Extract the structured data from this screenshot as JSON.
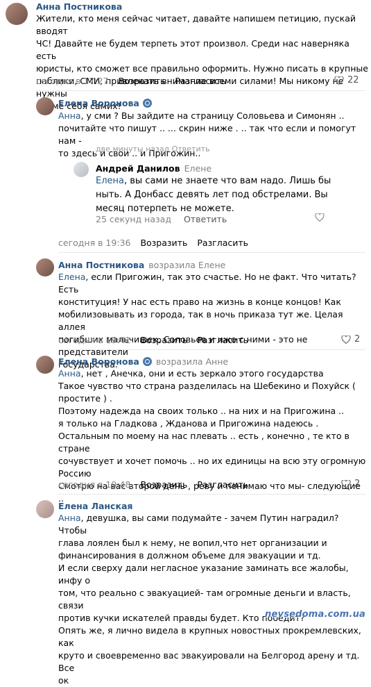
{
  "comments": [
    {
      "author": "Анна Постникова",
      "lines": [
        "Жители, кто меня сейчас читает, давайте напишем петицию, пускай вводят",
        "ЧС! Давайте не будем терпеть этот произвол. Среди нас наверняка есть",
        "юристы, кто сможет все правильно оформить. Нужно писать в крупные",
        "паблики, СМИ, привлекать внимание всеми силами! Мы никому не нужны",
        "кроме себя самих!"
      ],
      "time": "сегодня в 17:27",
      "reply": "Возразить",
      "share": "Разгласить",
      "likes": "22"
    },
    {
      "author": "Елена Воронова",
      "address": "Анна",
      "lines": [
        ", у сми ? Вы зайдите на страницу Соловьева и Симонян ..",
        "почитайте что пишут .. ... скрин ниже . .. так что если и помогут нам -",
        "то здесь и свои .. и Пригожин.."
      ],
      "ghost": "две минуты назад          Ответить"
    },
    {
      "author": "Андрей Данилов",
      "reply_to": "Елене",
      "address": "Елена",
      "lines": [
        ", вы сами не знаете что вам надо. Лишь бы",
        "ныть. А Донбасс девять лет под обстрелами. Вы",
        "месяц потерпеть не можете."
      ],
      "time": "25 секунд назад",
      "reply": "Ответить",
      "post_time": "сегодня в 19:36",
      "post_reply": "Возразить",
      "post_share": "Разгласить"
    },
    {
      "author": "Анна Постникова",
      "reply_to": "возразила Елене",
      "address": "Елена",
      "lines": [
        ", если Пригожин, так это счастье. Но не факт. Что читать? Есть",
        "конституция! У нас есть право на жизнь в конце концов! Как",
        "мобилизовывать из города, так в ночь приказа тут же. Целая аллея",
        "погибших мальчишек. Соловьев и иже с ними - это не представители",
        "государства."
      ],
      "time": "сегодня в 19:41",
      "reply": "Возразить",
      "share": "Разгласить",
      "likes": "2"
    },
    {
      "author": "Елена Воронова",
      "reply_to": "возразила Анне",
      "address": "Анна",
      "lines": [
        ", нет , Анечка, они и есть зеркало этого государства",
        "Такое чувство что страна разделилась на Шебекино и Похуйск (",
        "простите ) .",
        "Поэтому надежда на своих только .. на них и на Пригожина ..",
        "я только на Гладкова , Жданова и Пригожина надеюсь .",
        "Остальным по моему на нас плевать .. есть , конечно , те кто в стране",
        "сочувствует и хочет помочь .. но их единицы на всю эту огромную",
        "Россию",
        "Смотрю на вас второй день , реву и понимаю что мы- следующие .."
      ],
      "time": "сегодня в 19:48",
      "reply": "Возразить",
      "share": "Разгласить",
      "likes": "2"
    },
    {
      "author": "Елена Ланская",
      "address": "Анна",
      "lines": [
        ", девушка, вы сами подумайте - зачем Путин наградил? Чтобы",
        "глава лоялен был к нему, не вопил,что нет организации и",
        "финансирования в должном объеме для эвакуации и тд.",
        "И если сверху дали негласное указание заминать все жалобы, инфу о",
        "том, что реально с эвакуацией- там огромные деньги и власть, связи",
        "против кучки искателей правды будет. Кто победит?",
        "Опять же, я лично видела в крупных новостных прокремлевских, как",
        "круто и своевременно вас эвакуировали на Белгород арену и тд. Все",
        "ок"
      ]
    }
  ],
  "watermark": "nevsedoma.com.ua",
  "icons": {
    "heart": "heart-icon",
    "badge": "verified-badge-icon"
  },
  "colors": {
    "link": "#2a5885",
    "meta": "#828282",
    "divider": "#e7e8ec"
  }
}
